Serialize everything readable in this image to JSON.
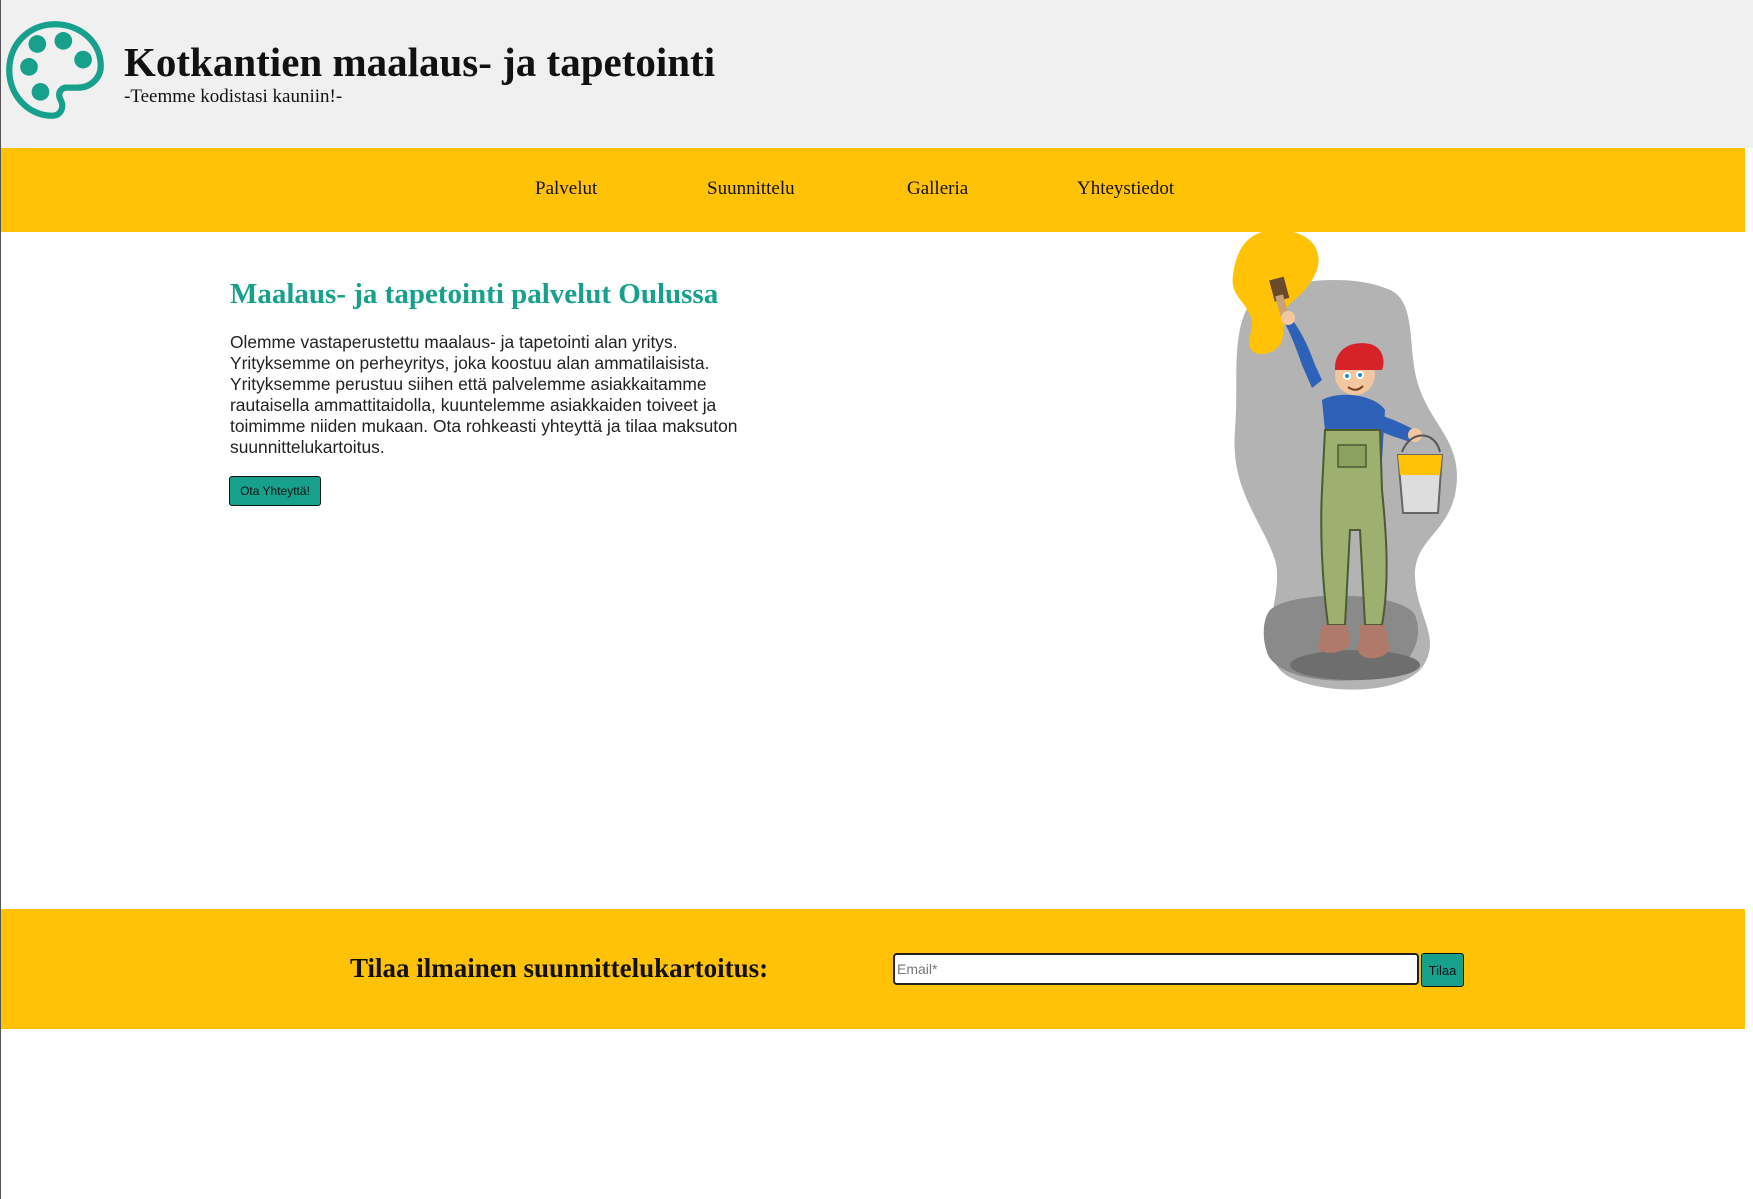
{
  "header": {
    "title": "Kotkantien maalaus- ja tapetointi",
    "tagline": "-Teemme kodistasi kauniin!-",
    "logo_icon": "palette-icon"
  },
  "nav": {
    "items": [
      {
        "label": "Palvelut"
      },
      {
        "label": "Suunnittelu"
      },
      {
        "label": "Galleria"
      },
      {
        "label": "Yhteystiedot"
      }
    ]
  },
  "hero": {
    "heading": "Maalaus- ja tapetointi palvelut Oulussa",
    "text": "Olemme vastaperustettu maalaus- ja tapetointi alan yritys. Yrityksemme on perheyritys, joka koostuu alan ammatilaisista. Yrityksemme perustuu siihen että palvelemme asiakkaitamme rautaisella ammattitaidolla, kuuntelemme asiakkaiden toiveet ja toimimme niiden mukaan. Ota rohkeasti yhteyttä ja tilaa maksuton suunnittelukartoitus.",
    "cta_label": "Ota Yhteyttä!",
    "illustration": "painter-illustration"
  },
  "signup": {
    "label": "Tilaa ilmainen suunnittelukartoitus:",
    "email_placeholder": "Email*",
    "email_value": "",
    "submit_label": "Tilaa"
  },
  "colors": {
    "accent": "#17a08c",
    "band": "#ffc206",
    "header_bg": "#f0f0f0"
  }
}
